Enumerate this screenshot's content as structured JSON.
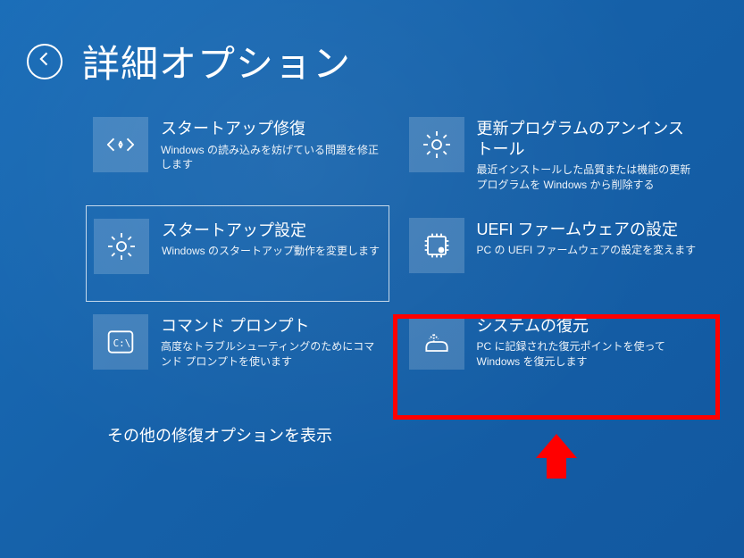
{
  "header": {
    "title": "詳細オプション"
  },
  "tiles": [
    {
      "title": "スタートアップ修復",
      "desc": "Windows の読み込みを妨げている問題を修正します"
    },
    {
      "title": "更新プログラムのアンインストール",
      "desc": "最近インストールした品質または機能の更新プログラムを Windows から削除する"
    },
    {
      "title": "スタートアップ設定",
      "desc": "Windows のスタートアップ動作を変更します"
    },
    {
      "title": "UEFI ファームウェアの設定",
      "desc": "PC の UEFI ファームウェアの設定を変えます"
    },
    {
      "title": "コマンド プロンプト",
      "desc": "高度なトラブルシューティングのためにコマンド プロンプトを使います"
    },
    {
      "title": "システムの復元",
      "desc": "PC に記録された復元ポイントを使って Windows を復元します"
    }
  ],
  "more_link": "その他の修復オプションを表示"
}
